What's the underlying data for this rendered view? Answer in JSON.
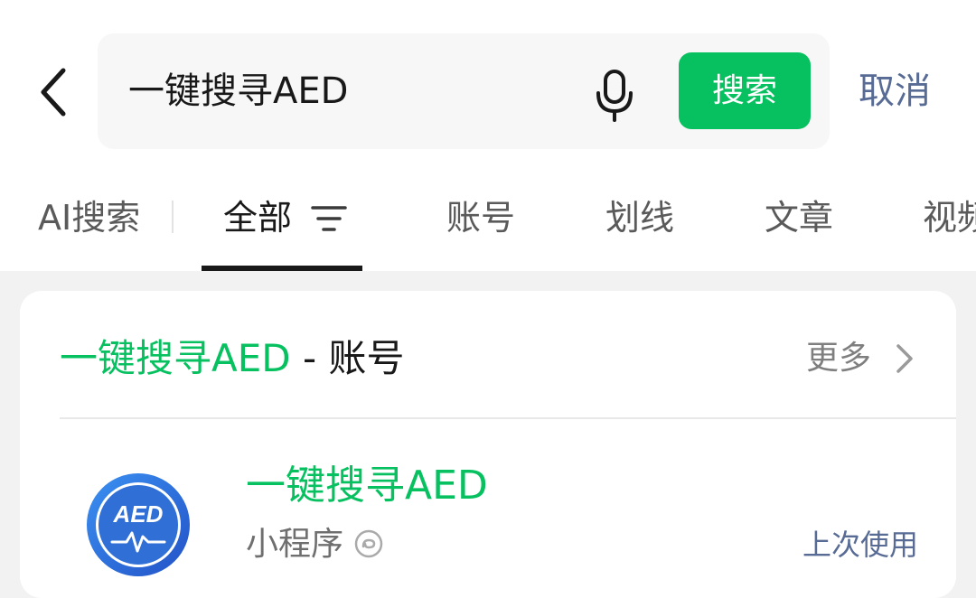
{
  "search": {
    "query": "一键搜寻AED",
    "button_label": "搜索",
    "cancel_label": "取消"
  },
  "tabs": [
    {
      "label": "AI搜索"
    },
    {
      "label": "全部",
      "active": true
    },
    {
      "label": "账号"
    },
    {
      "label": "划线"
    },
    {
      "label": "文章"
    },
    {
      "label": "视频"
    }
  ],
  "section": {
    "title_keyword": "一键搜寻AED",
    "title_suffix": " - 账号",
    "more_label": "更多"
  },
  "result": {
    "title": "一键搜寻AED",
    "type": "小程序",
    "action_label": "上次使用",
    "logo_text": "AED"
  },
  "colors": {
    "accent_green": "#07c160",
    "link_blue": "#576b95",
    "logo_blue": "#2f6fd6"
  },
  "icons": {
    "back": "chevron-left-icon",
    "mic": "microphone-icon",
    "filter": "filter-icon",
    "more": "chevron-right-icon",
    "mini_program": "mini-program-icon"
  }
}
